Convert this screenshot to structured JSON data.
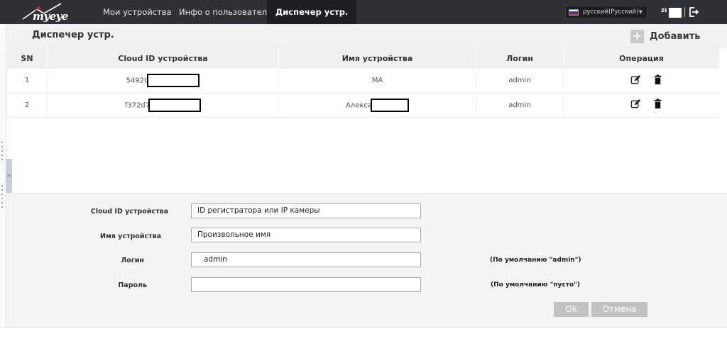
{
  "nav": {
    "logo_text": "myeye",
    "items": [
      {
        "label": "Мои устройства"
      },
      {
        "label": "Инфо о пользователе"
      },
      {
        "label": "Диспечер устр."
      }
    ],
    "language": "русский(Русский)",
    "user": "zı"
  },
  "colors": {
    "topbar": "#2f3137",
    "logo_accent": "#d62a2a",
    "header_bg": "#f1f1f1",
    "form_bg": "#f4f4f4",
    "button_bg": "#c2c2c2"
  },
  "page": {
    "title": "Диспечер устр.",
    "add_label": "Добавить"
  },
  "table": {
    "columns": [
      "SN",
      "Cloud ID устройства",
      "Имя устройства",
      "Логин",
      "Операция"
    ],
    "rows": [
      {
        "sn": "1",
        "cloud_id": "54920",
        "name": "MA",
        "login": "admin"
      },
      {
        "sn": "2",
        "cloud_id": "f372d7",
        "name": "Алекса",
        "login": "admin"
      }
    ]
  },
  "form": {
    "cloud_id_label": "Cloud ID устройства",
    "cloud_id_value": "ID регистратора или IP камеры",
    "name_label": "Имя устройства",
    "name_value": "Произвольное имя",
    "login_label": "Логин",
    "login_value": "admin",
    "login_note": "(По умолчанию \"admin\")",
    "password_label": "Пароль",
    "password_value": "",
    "password_note": "(По умолчанию \"пусто\")",
    "ok_label": "Ok",
    "cancel_label": "Отмена"
  }
}
